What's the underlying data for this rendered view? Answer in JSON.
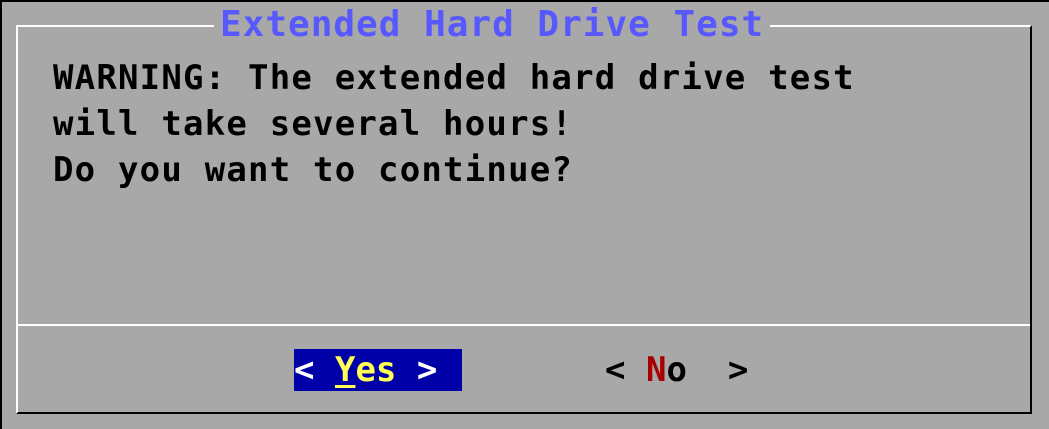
{
  "dialog": {
    "title": "Extended Hard Drive Test",
    "message_lines": [
      "WARNING: The extended hard drive test",
      "will take several hours!",
      "Do you want to continue?"
    ]
  },
  "buttons": {
    "yes": {
      "bracket_left": "< ",
      "hotkey": "Y",
      "rest": "es",
      "bracket_right": " >"
    },
    "no": {
      "bracket_left": "< ",
      "hotkey": "N",
      "rest": "o",
      "bracket_right": "  >"
    }
  },
  "colors": {
    "background": "#a8a8a8",
    "title": "#5858ff",
    "selected_button_bg": "#0000a8",
    "hotkey_selected": "#ffff54",
    "hotkey_unselected": "#a80000"
  }
}
